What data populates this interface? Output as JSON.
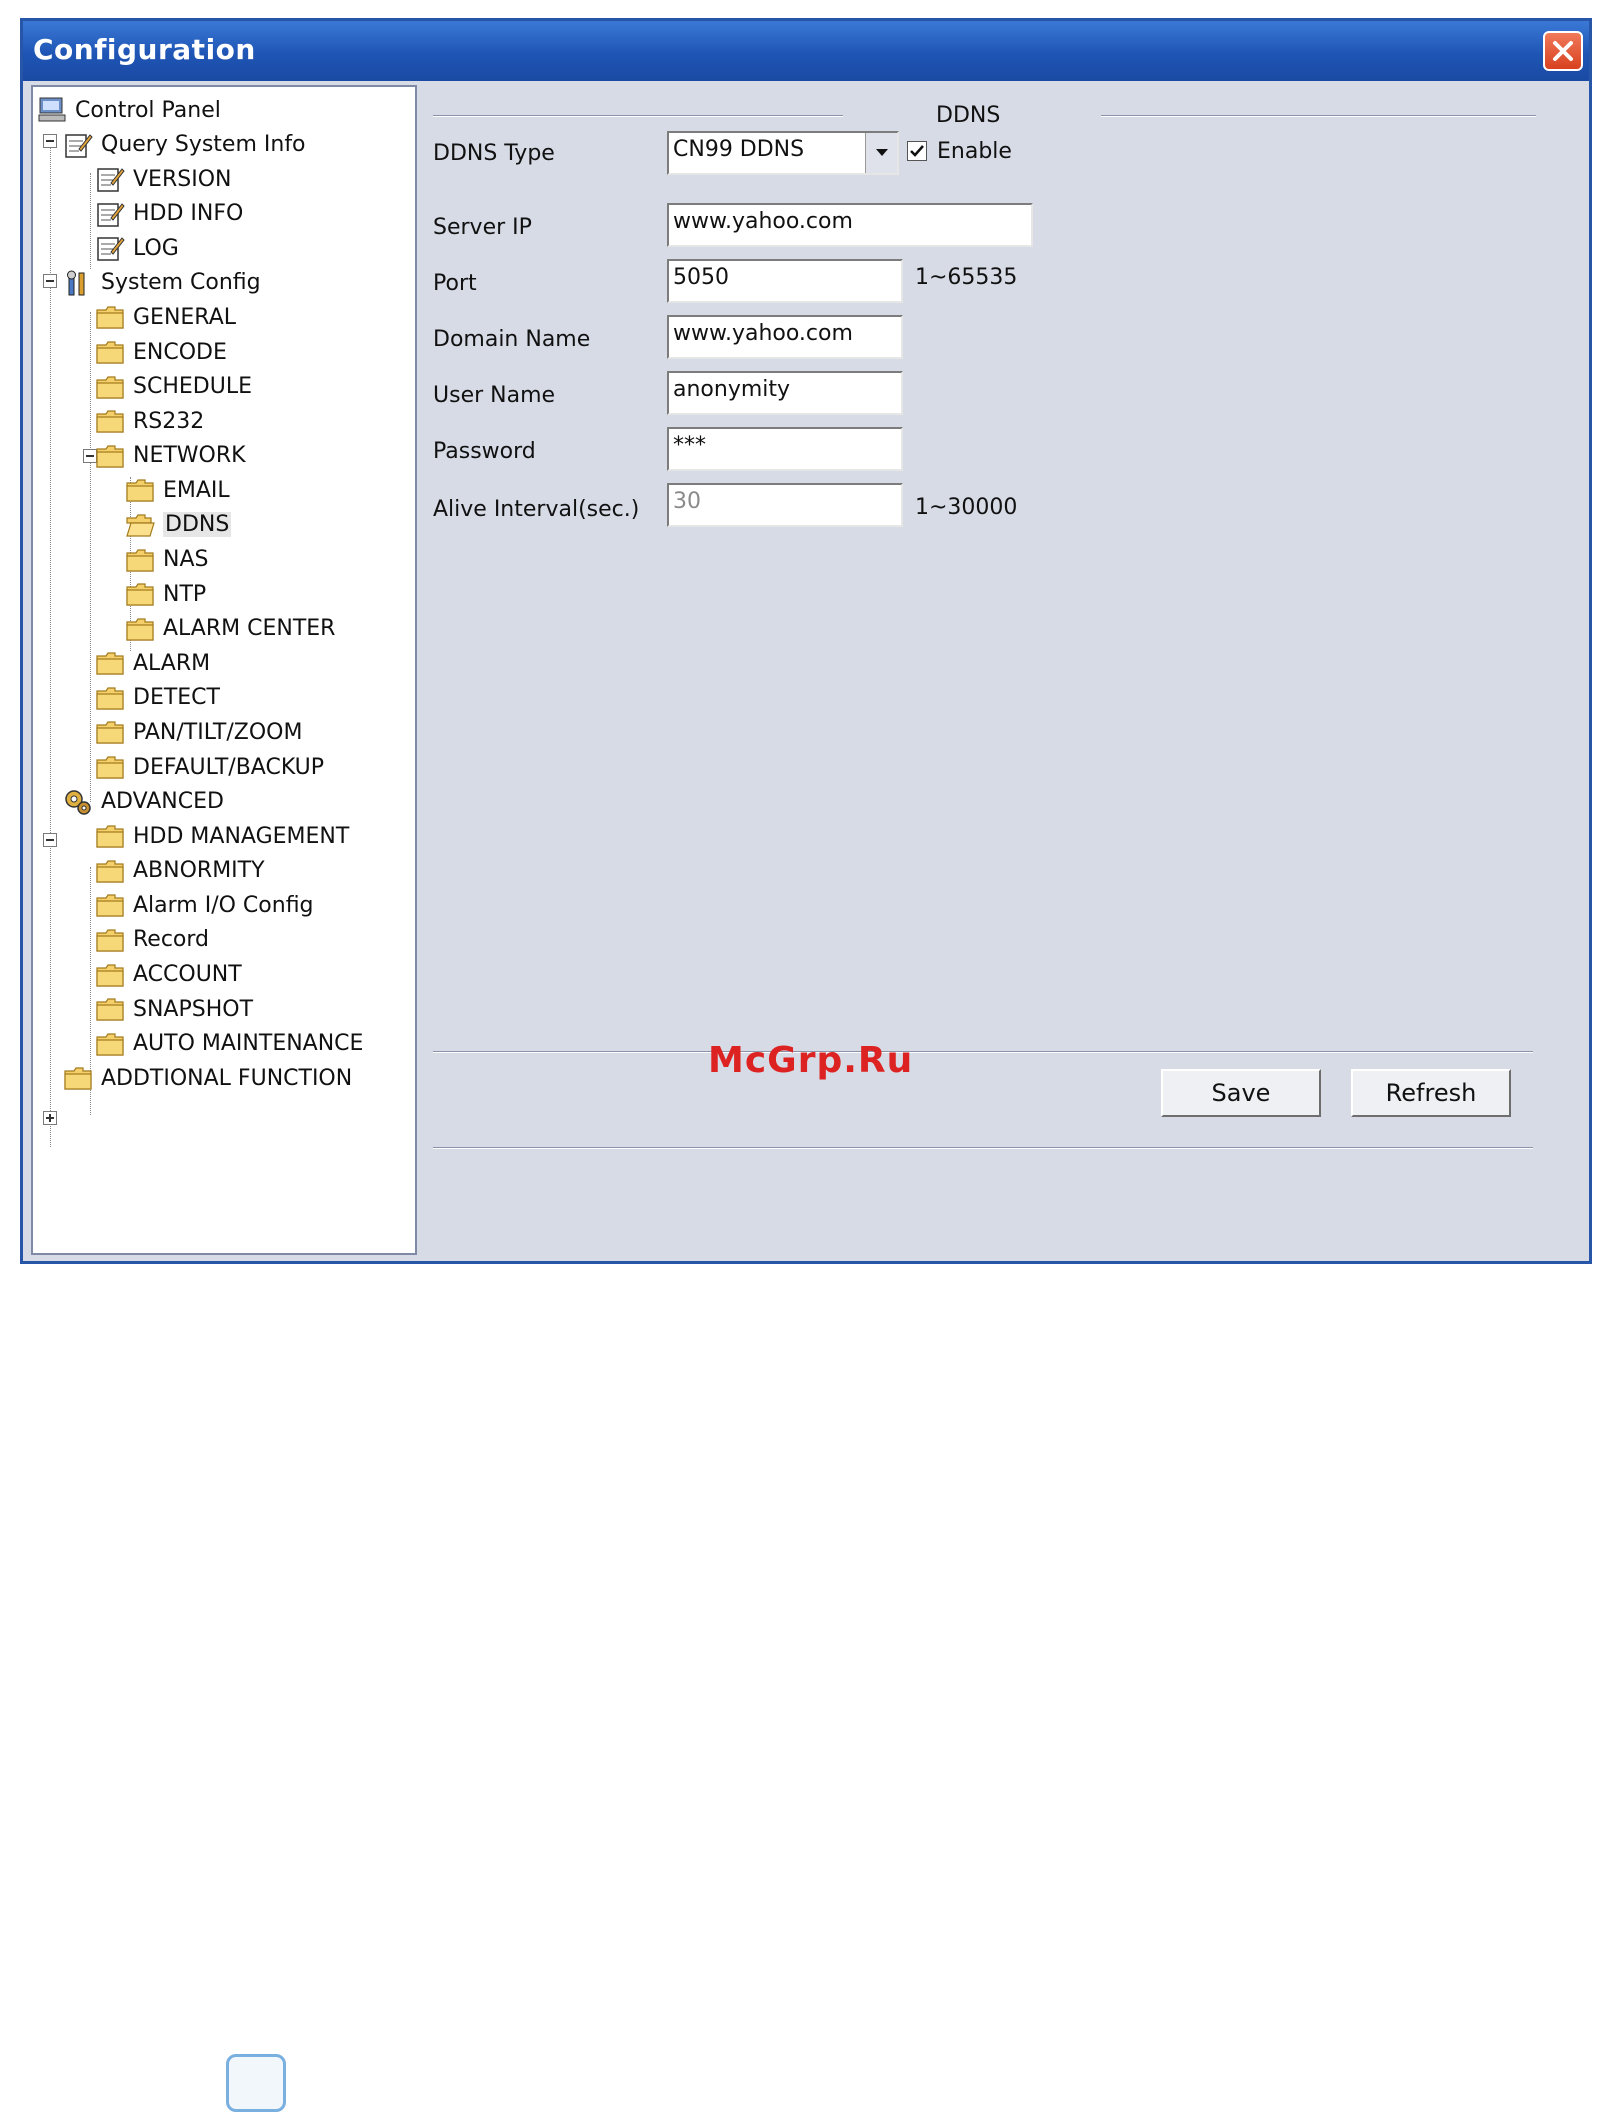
{
  "window": {
    "title": "Configuration"
  },
  "tree": {
    "items": [
      {
        "label": "Control Panel",
        "icon": "computer-icon",
        "level": 0
      },
      {
        "label": "Query System Info",
        "icon": "notepad-icon",
        "level": 1
      },
      {
        "label": "VERSION",
        "icon": "notepad-icon",
        "level": 2
      },
      {
        "label": "HDD INFO",
        "icon": "notepad-icon",
        "level": 2
      },
      {
        "label": "LOG",
        "icon": "notepad-icon",
        "level": 2
      },
      {
        "label": "System Config",
        "icon": "tools-icon",
        "level": 1
      },
      {
        "label": "GENERAL",
        "icon": "folder-icon",
        "level": 2
      },
      {
        "label": "ENCODE",
        "icon": "folder-icon",
        "level": 2
      },
      {
        "label": "SCHEDULE",
        "icon": "folder-icon",
        "level": 2
      },
      {
        "label": "RS232",
        "icon": "folder-icon",
        "level": 2
      },
      {
        "label": "NETWORK",
        "icon": "folder-icon",
        "level": 2
      },
      {
        "label": "EMAIL",
        "icon": "folder-icon",
        "level": 3
      },
      {
        "label": "DDNS",
        "icon": "folder-open-icon",
        "level": 3
      },
      {
        "label": "NAS",
        "icon": "folder-icon",
        "level": 3
      },
      {
        "label": "NTP",
        "icon": "folder-icon",
        "level": 3
      },
      {
        "label": "ALARM CENTER",
        "icon": "folder-icon",
        "level": 3
      },
      {
        "label": "ALARM",
        "icon": "folder-icon",
        "level": 2
      },
      {
        "label": "DETECT",
        "icon": "folder-icon",
        "level": 2
      },
      {
        "label": "PAN/TILT/ZOOM",
        "icon": "folder-icon",
        "level": 2
      },
      {
        "label": "DEFAULT/BACKUP",
        "icon": "folder-icon",
        "level": 2
      },
      {
        "label": "ADVANCED",
        "icon": "gears-icon",
        "level": 1
      },
      {
        "label": "HDD MANAGEMENT",
        "icon": "folder-icon",
        "level": 2
      },
      {
        "label": "ABNORMITY",
        "icon": "folder-icon",
        "level": 2
      },
      {
        "label": "Alarm I/O Config",
        "icon": "folder-icon",
        "level": 2
      },
      {
        "label": "Record",
        "icon": "folder-icon",
        "level": 2
      },
      {
        "label": "ACCOUNT",
        "icon": "folder-icon",
        "level": 2
      },
      {
        "label": "SNAPSHOT",
        "icon": "folder-icon",
        "level": 2
      },
      {
        "label": "AUTO MAINTENANCE",
        "icon": "folder-icon",
        "level": 2
      },
      {
        "label": "ADDTIONAL FUNCTION",
        "icon": "folder-icon",
        "level": 1
      }
    ]
  },
  "ddns": {
    "section_title": "DDNS",
    "type_label": "DDNS Type",
    "type_value": "CN99 DDNS",
    "enable_label": "Enable",
    "enable_checked": true,
    "server_ip_label": "Server IP",
    "server_ip_value": "www.yahoo.com",
    "port_label": "Port",
    "port_value": "5050",
    "port_range": "1~65535",
    "domain_label": "Domain Name",
    "domain_value": "www.yahoo.com",
    "user_label": "User Name",
    "user_value": "anonymity",
    "password_label": "Password",
    "password_value": "***",
    "alive_label": "Alive Interval(sec.)",
    "alive_value": "30",
    "alive_range": "1~30000"
  },
  "buttons": {
    "save": "Save",
    "refresh": "Refresh"
  },
  "watermark": "McGrp.Ru"
}
